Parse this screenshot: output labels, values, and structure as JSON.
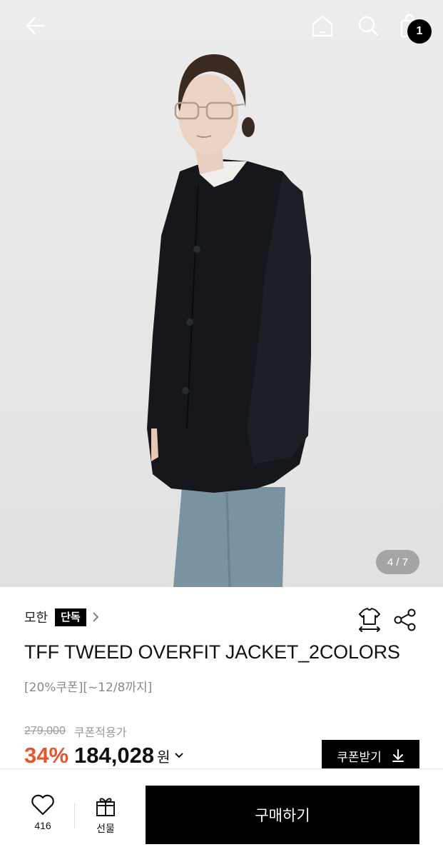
{
  "header": {
    "cart_count": "1"
  },
  "gallery": {
    "counter": "4 / 7"
  },
  "product": {
    "brand": "모한",
    "exclusive_badge": "단독",
    "title": "TFF TWEED OVERFIT JACKET_2COLORS",
    "subtitle": "[20%쿠폰][~12/8까지]",
    "original_price": "279,000",
    "coupon_note": "쿠폰적용가",
    "discount": "34%",
    "sale_price": "184,028",
    "currency": "원",
    "coupon_button": "쿠폰받기"
  },
  "bottom_bar": {
    "like_count": "416",
    "gift_label": "선물",
    "buy_label": "구매하기"
  },
  "colors": {
    "accent": "#e8542c",
    "primary": "#000000"
  }
}
